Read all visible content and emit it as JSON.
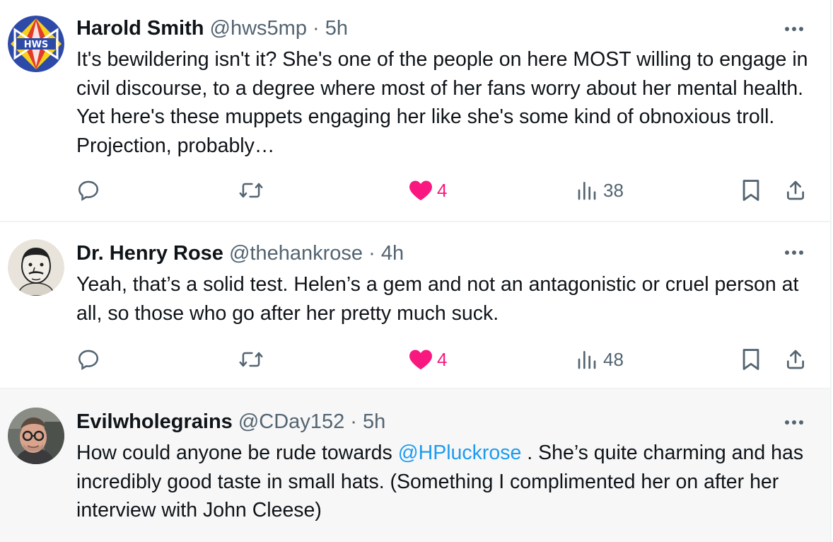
{
  "tweets": [
    {
      "name": "Harold Smith",
      "handle": "@hws5mp",
      "sep": "·",
      "time": "5h",
      "text": "It's bewildering isn't it? She's one of the people on here MOST willing to engage in civil discourse, to a degree where most of her fans worry about her mental health. Yet here's these muppets engaging her like she's some kind of obnoxious troll. Projection, probably…",
      "likes": "4",
      "views": "38",
      "liked": true,
      "avatar_icon": "hws-logo-icon"
    },
    {
      "name": "Dr. Henry Rose",
      "handle": "@thehankrose",
      "sep": "·",
      "time": "4h",
      "text": "Yeah, that’s a solid test. Helen’s a gem and not an antagonistic or cruel person at all, so those who go after her pretty much suck.",
      "likes": "4",
      "views": "48",
      "liked": true,
      "avatar_icon": "sketch-portrait-icon"
    },
    {
      "name": "Evilwholegrains",
      "handle": "@CDay152",
      "sep": "·",
      "time": "5h",
      "text_before": "How could anyone be rude towards ",
      "mention": "@HPluckrose",
      "text_after": " . She’s quite charming and has incredibly good taste in small hats. (Something I complimented her on after her interview with John Cleese)",
      "avatar_icon": "photo-avatar-icon"
    }
  ],
  "colors": {
    "like_pink": "#f91880",
    "link_blue": "#1d9bf0",
    "secondary_text": "#536471",
    "hover_bg": "#f7f7f7",
    "divider": "#eff3f4"
  },
  "icons": [
    "reply-icon",
    "retweet-icon",
    "heart-icon",
    "views-icon",
    "bookmark-icon",
    "share-icon",
    "more-icon"
  ]
}
